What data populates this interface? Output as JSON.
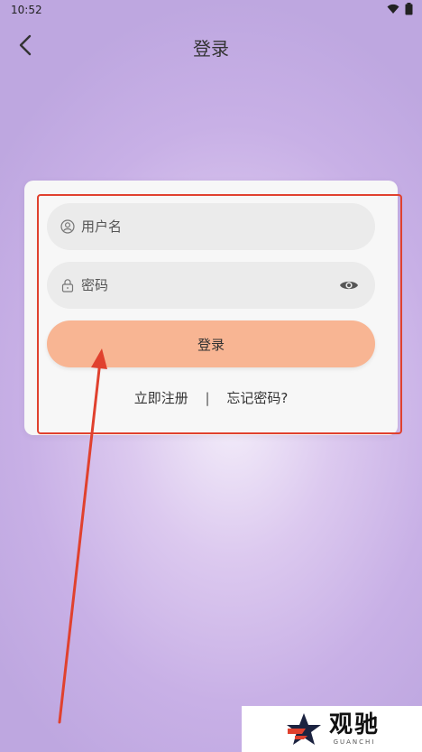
{
  "status": {
    "time": "10:52"
  },
  "nav": {
    "title": "登录"
  },
  "form": {
    "username_placeholder": "用户名",
    "password_placeholder": "密码",
    "login_label": "登录",
    "register_label": "立即注册",
    "separator": "|",
    "forgot_label": "忘记密码?"
  },
  "watermark": {
    "main": "观驰",
    "sub": "GUANCHI"
  },
  "colors": {
    "accent_button": "#f8b593",
    "annotation_red": "#e0412e"
  }
}
